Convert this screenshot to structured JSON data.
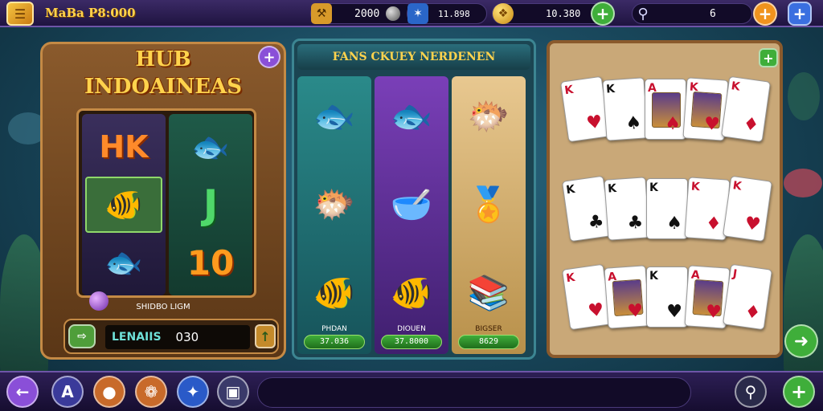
{
  "top_bar": {
    "title": "MaBa P8:000",
    "coins_value": "2000",
    "gems_value": "11.898",
    "gold_value": "10.380",
    "search_count": "6"
  },
  "left_panel": {
    "title_line1": "HUB",
    "title_line2": "INDOAINEAS",
    "reel_symbols": [
      "HK",
      "J",
      "10"
    ],
    "label": "SHIDBO LIGM",
    "bet_label": "LENAIIS",
    "bet_value": "030"
  },
  "middle_panel": {
    "header": "FANS CKUEY NERDENEN",
    "columns": [
      {
        "label": "PHDAN",
        "price": "37.036"
      },
      {
        "label": "DIOUEN",
        "price": "37.8000"
      },
      {
        "label": "BIGSER",
        "price": "8629"
      }
    ]
  },
  "right_panel": {
    "row1": [
      {
        "rank": "K",
        "suit": "♥",
        "color": "red"
      },
      {
        "rank": "K",
        "suit": "♠",
        "color": "black"
      },
      {
        "rank": "A",
        "suit": "♠",
        "color": "red"
      },
      {
        "rank": "K",
        "suit": "♥",
        "color": "red"
      },
      {
        "rank": "K",
        "suit": "♦",
        "color": "red"
      }
    ],
    "row2": [
      {
        "rank": "K",
        "suit": "♣",
        "color": "black"
      },
      {
        "rank": "K",
        "suit": "♣",
        "color": "black"
      },
      {
        "rank": "K",
        "suit": "♠",
        "color": "black"
      },
      {
        "rank": "K",
        "suit": "♦",
        "color": "red"
      },
      {
        "rank": "K",
        "suit": "♥",
        "color": "red"
      }
    ],
    "row3": [
      {
        "rank": "K",
        "suit": "♥",
        "color": "red"
      },
      {
        "rank": "A",
        "suit": "♥",
        "color": "red"
      },
      {
        "rank": "K",
        "suit": "♥",
        "color": "black"
      },
      {
        "rank": "A",
        "suit": "♥",
        "color": "red"
      },
      {
        "rank": "J",
        "suit": "♦",
        "color": "red"
      }
    ]
  },
  "bottom_bar": {
    "a_label": "A"
  },
  "colors": {
    "accent_gold": "#ffd34d",
    "green": "#3fae3a",
    "purple": "#6e55a8"
  }
}
